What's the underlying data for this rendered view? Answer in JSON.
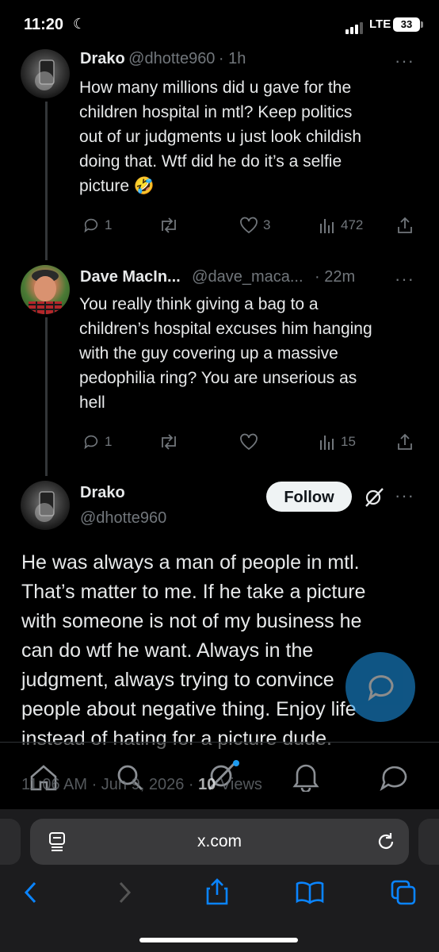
{
  "status": {
    "time": "11:20",
    "network": "LTE",
    "battery": "33"
  },
  "tweets": [
    {
      "name": "Drako",
      "handle": "@dhotte960",
      "age": "· 1h",
      "lines": [
        "How many millions did u gave for the",
        "children hospital in mtl? Keep politics",
        "out of ur judgments u just look childish",
        "doing that. Wtf did he do it’s a selfie",
        "picture 🤣"
      ],
      "replies": "1",
      "likes": "3",
      "views": "472"
    },
    {
      "name": "Dave MacIn...",
      "handle": "@dave_maca...",
      "age": "· 22m",
      "lines": [
        "You really think giving a bag to a",
        "children’s hospital excuses him hanging",
        "with the guy covering up a massive",
        "pedophilia ring? You are unserious as",
        "hell"
      ],
      "replies": "1",
      "likes": "",
      "views": "15"
    }
  ],
  "main_tweet": {
    "name": "Drako",
    "handle": "@dhotte960",
    "follow_label": "Follow",
    "lines": [
      "He was always a man of people in mtl.",
      "That’s matter to me. If  he take a picture",
      "with someone is not of my business he",
      "can do wtf he want. Always in the",
      "judgment, always trying to convince",
      "people about negative thing. Enjoy life",
      "instead of hating for a picture dude."
    ],
    "meta_time": "11:06 AM · Jun 9, 2026 · ",
    "meta_views_count": "10",
    "meta_views_label": " Views"
  },
  "more_icon": "···",
  "browser": {
    "url": "x.com"
  },
  "colors": {
    "accent": "#1d9bf0",
    "muted": "#71767b",
    "background": "#000000"
  }
}
